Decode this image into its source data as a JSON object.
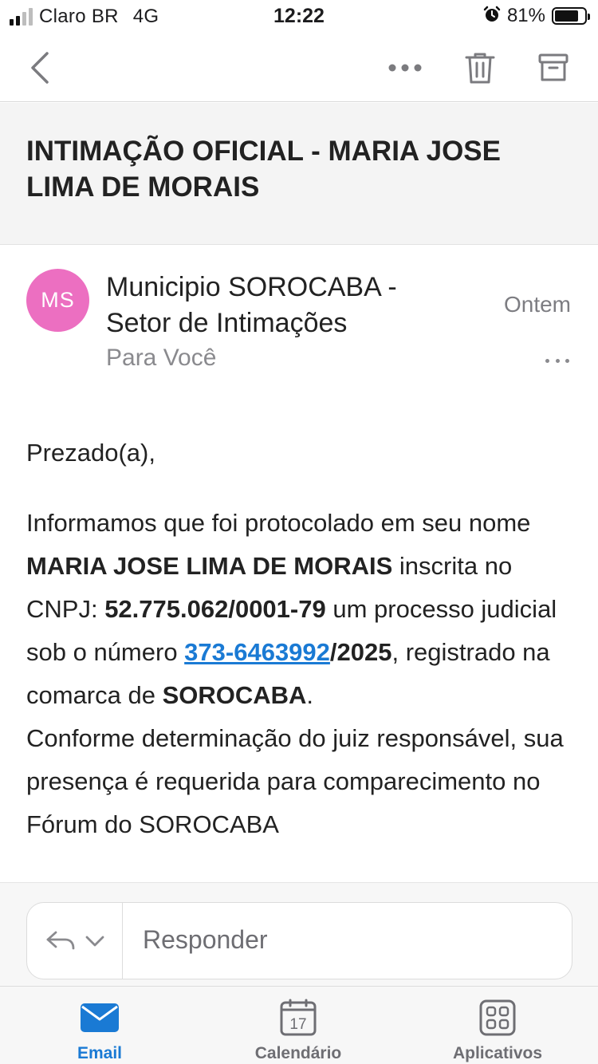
{
  "status_bar": {
    "carrier": "Claro BR",
    "network": "4G",
    "time": "12:22",
    "battery_percent": "81%",
    "battery_level": 0.81
  },
  "nav": {
    "back_icon": "chevron-left-icon",
    "more_icon": "ellipsis-icon",
    "delete_icon": "trash-icon",
    "archive_icon": "archive-box-icon"
  },
  "email": {
    "subject": "INTIMAÇÃO OFICIAL - MARIA JOSE LIMA DE MORAIS",
    "avatar_initials": "MS",
    "avatar_color": "#ec6fc1",
    "sender": "Municipio SOROCABA - Setor de Intimações",
    "recipient": "Para Você",
    "date": "Ontem",
    "body": {
      "greeting": "Prezado(a),",
      "p1_a": "Informamos que foi protocolado em seu nome ",
      "p1_name": "MARIA JOSE LIMA DE MORAIS",
      "p1_b": " inscrita no CNPJ: ",
      "p1_cnpj": "52.775.062/0001-79",
      "p1_c": " um processo judicial sob o número ",
      "p1_process_link": "373-6463992",
      "p1_process_suffix": "/2025",
      "p1_d": ", registrado na comarca de ",
      "p1_comarca": "SOROCABA",
      "p1_e": ".",
      "p2": "Conforme determinação do juiz responsável, sua presença é requerida para comparecimento no Fórum do SOROCABA"
    }
  },
  "reply": {
    "placeholder": "Responder"
  },
  "tabs": [
    {
      "label": "Email",
      "icon": "envelope-icon",
      "active": true
    },
    {
      "label": "Calendário",
      "icon": "calendar-icon",
      "active": false,
      "day": "17"
    },
    {
      "label": "Aplicativos",
      "icon": "apps-grid-icon",
      "active": false
    }
  ],
  "colors": {
    "accent": "#1a7ad4",
    "subject_bg": "#f4f4f4"
  }
}
